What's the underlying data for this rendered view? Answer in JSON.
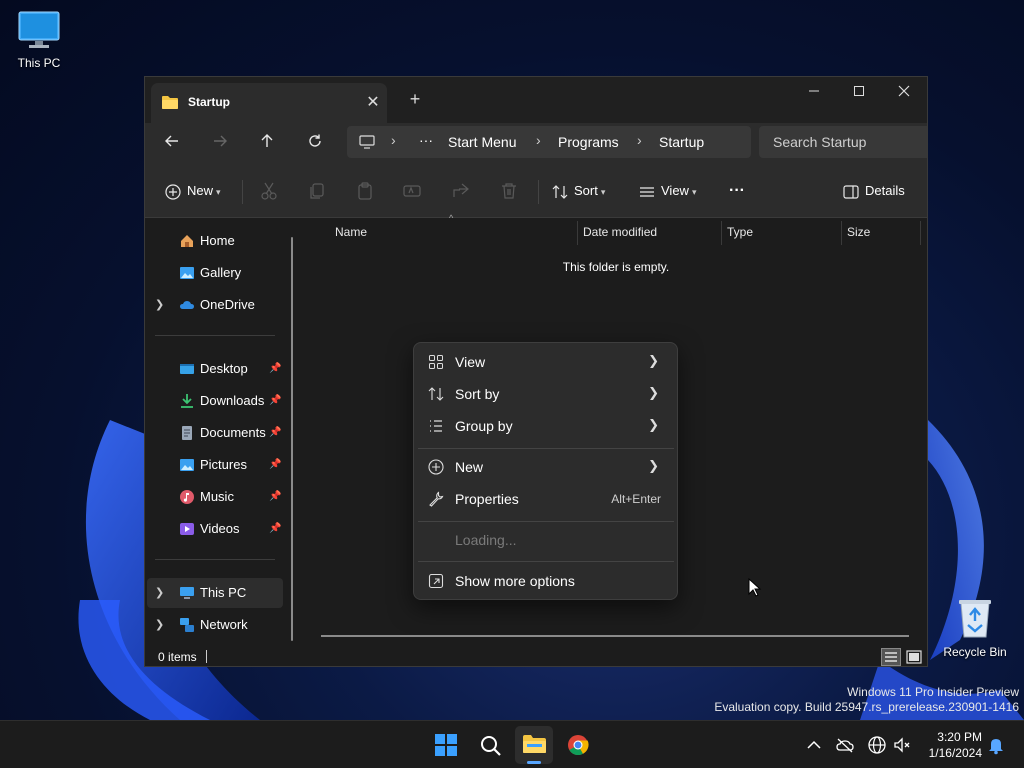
{
  "desktop": {
    "icons": [
      {
        "label": "This PC"
      },
      {
        "label": "Recycle Bin"
      }
    ],
    "watermark": {
      "line1": "Windows 11 Pro Insider Preview",
      "line2": "Evaluation copy. Build 25947.rs_prerelease.230901-1416"
    }
  },
  "window": {
    "tab_title": "Startup",
    "new_tab_glyph": "+",
    "close_glyph": "✕",
    "breadcrumb": [
      "Start Menu",
      "Programs",
      "Startup"
    ],
    "breadcrumb_more": "···",
    "search_placeholder": "Search Startup",
    "toolbar": {
      "new_label": "New",
      "sort_label": "Sort",
      "view_label": "View",
      "more_label": "···",
      "details_label": "Details"
    },
    "sidebar": {
      "items": [
        {
          "label": "Home"
        },
        {
          "label": "Gallery"
        },
        {
          "label": "OneDrive"
        },
        {
          "label": "Desktop"
        },
        {
          "label": "Downloads"
        },
        {
          "label": "Documents"
        },
        {
          "label": "Pictures"
        },
        {
          "label": "Music"
        },
        {
          "label": "Videos"
        },
        {
          "label": "This PC"
        },
        {
          "label": "Network"
        }
      ]
    },
    "columns": [
      "Name",
      "Date modified",
      "Type",
      "Size"
    ],
    "empty_text": "This folder is empty.",
    "status_text": "0 items"
  },
  "context_menu": {
    "items": [
      {
        "label": "View",
        "has_submenu": true
      },
      {
        "label": "Sort by",
        "has_submenu": true
      },
      {
        "label": "Group by",
        "has_submenu": true
      },
      {
        "label": "New",
        "has_submenu": true
      },
      {
        "label": "Properties",
        "shortcut": "Alt+Enter"
      },
      {
        "label": "Loading...",
        "disabled": true
      },
      {
        "label": "Show more options"
      }
    ]
  },
  "taskbar": {
    "time": "3:20 PM",
    "date": "1/16/2024"
  },
  "colors": {
    "accent": "#58a6ff",
    "window_bg": "#1c1c1c",
    "toolbar_bg": "#2c2c2c",
    "folder_yellow": "#f4c542"
  }
}
